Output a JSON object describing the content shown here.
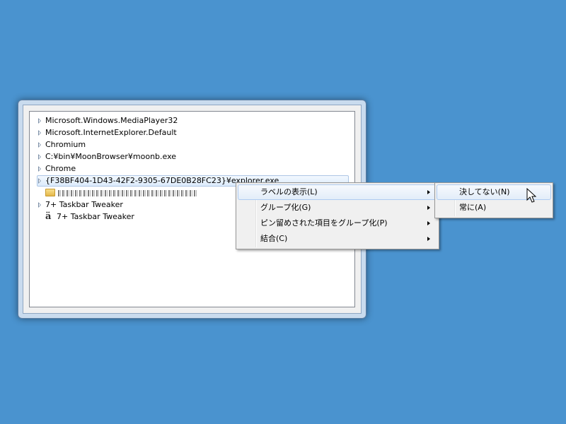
{
  "tree": {
    "items": [
      {
        "label": "Microsoft.Windows.MediaPlayer32",
        "type": "group"
      },
      {
        "label": "Microsoft.InternetExplorer.Default",
        "type": "group"
      },
      {
        "label": "Chromium",
        "type": "group"
      },
      {
        "label": "C:¥bin¥MoonBrowser¥moonb.exe",
        "type": "group"
      },
      {
        "label": "Chrome",
        "type": "group"
      },
      {
        "label": "{F38BF404-1D43-42F2-9305-67DE0B28FC23}¥explorer.exe",
        "type": "group",
        "selected": true
      },
      {
        "label": "",
        "type": "folder-child"
      },
      {
        "label": "7+ Taskbar Tweaker",
        "type": "group"
      },
      {
        "label": "7+ Taskbar Tweaker",
        "type": "app-child"
      }
    ]
  },
  "context_menu": {
    "items": [
      {
        "label": "ラベルの表示(L)",
        "highlighted": true
      },
      {
        "label": "グループ化(G)",
        "highlighted": false
      },
      {
        "label": "ピン留めされた項目をグループ化(P)",
        "highlighted": false
      },
      {
        "label": "結合(C)",
        "highlighted": false
      }
    ]
  },
  "submenu": {
    "items": [
      {
        "label": "決してない(N)",
        "highlighted": true
      },
      {
        "label": "常に(A)",
        "highlighted": false
      }
    ]
  },
  "icons": {
    "expander": "tree-expander-icon",
    "folder": "folder-icon",
    "app": "taskbar-tweaker-icon",
    "submenu_arrow": "submenu-arrow-icon",
    "cursor": "mouse-pointer-icon"
  },
  "colors": {
    "desktop": "#4a93cf",
    "selection_border": "#adc6e5",
    "menu_highlight_border": "#aecbf1"
  }
}
